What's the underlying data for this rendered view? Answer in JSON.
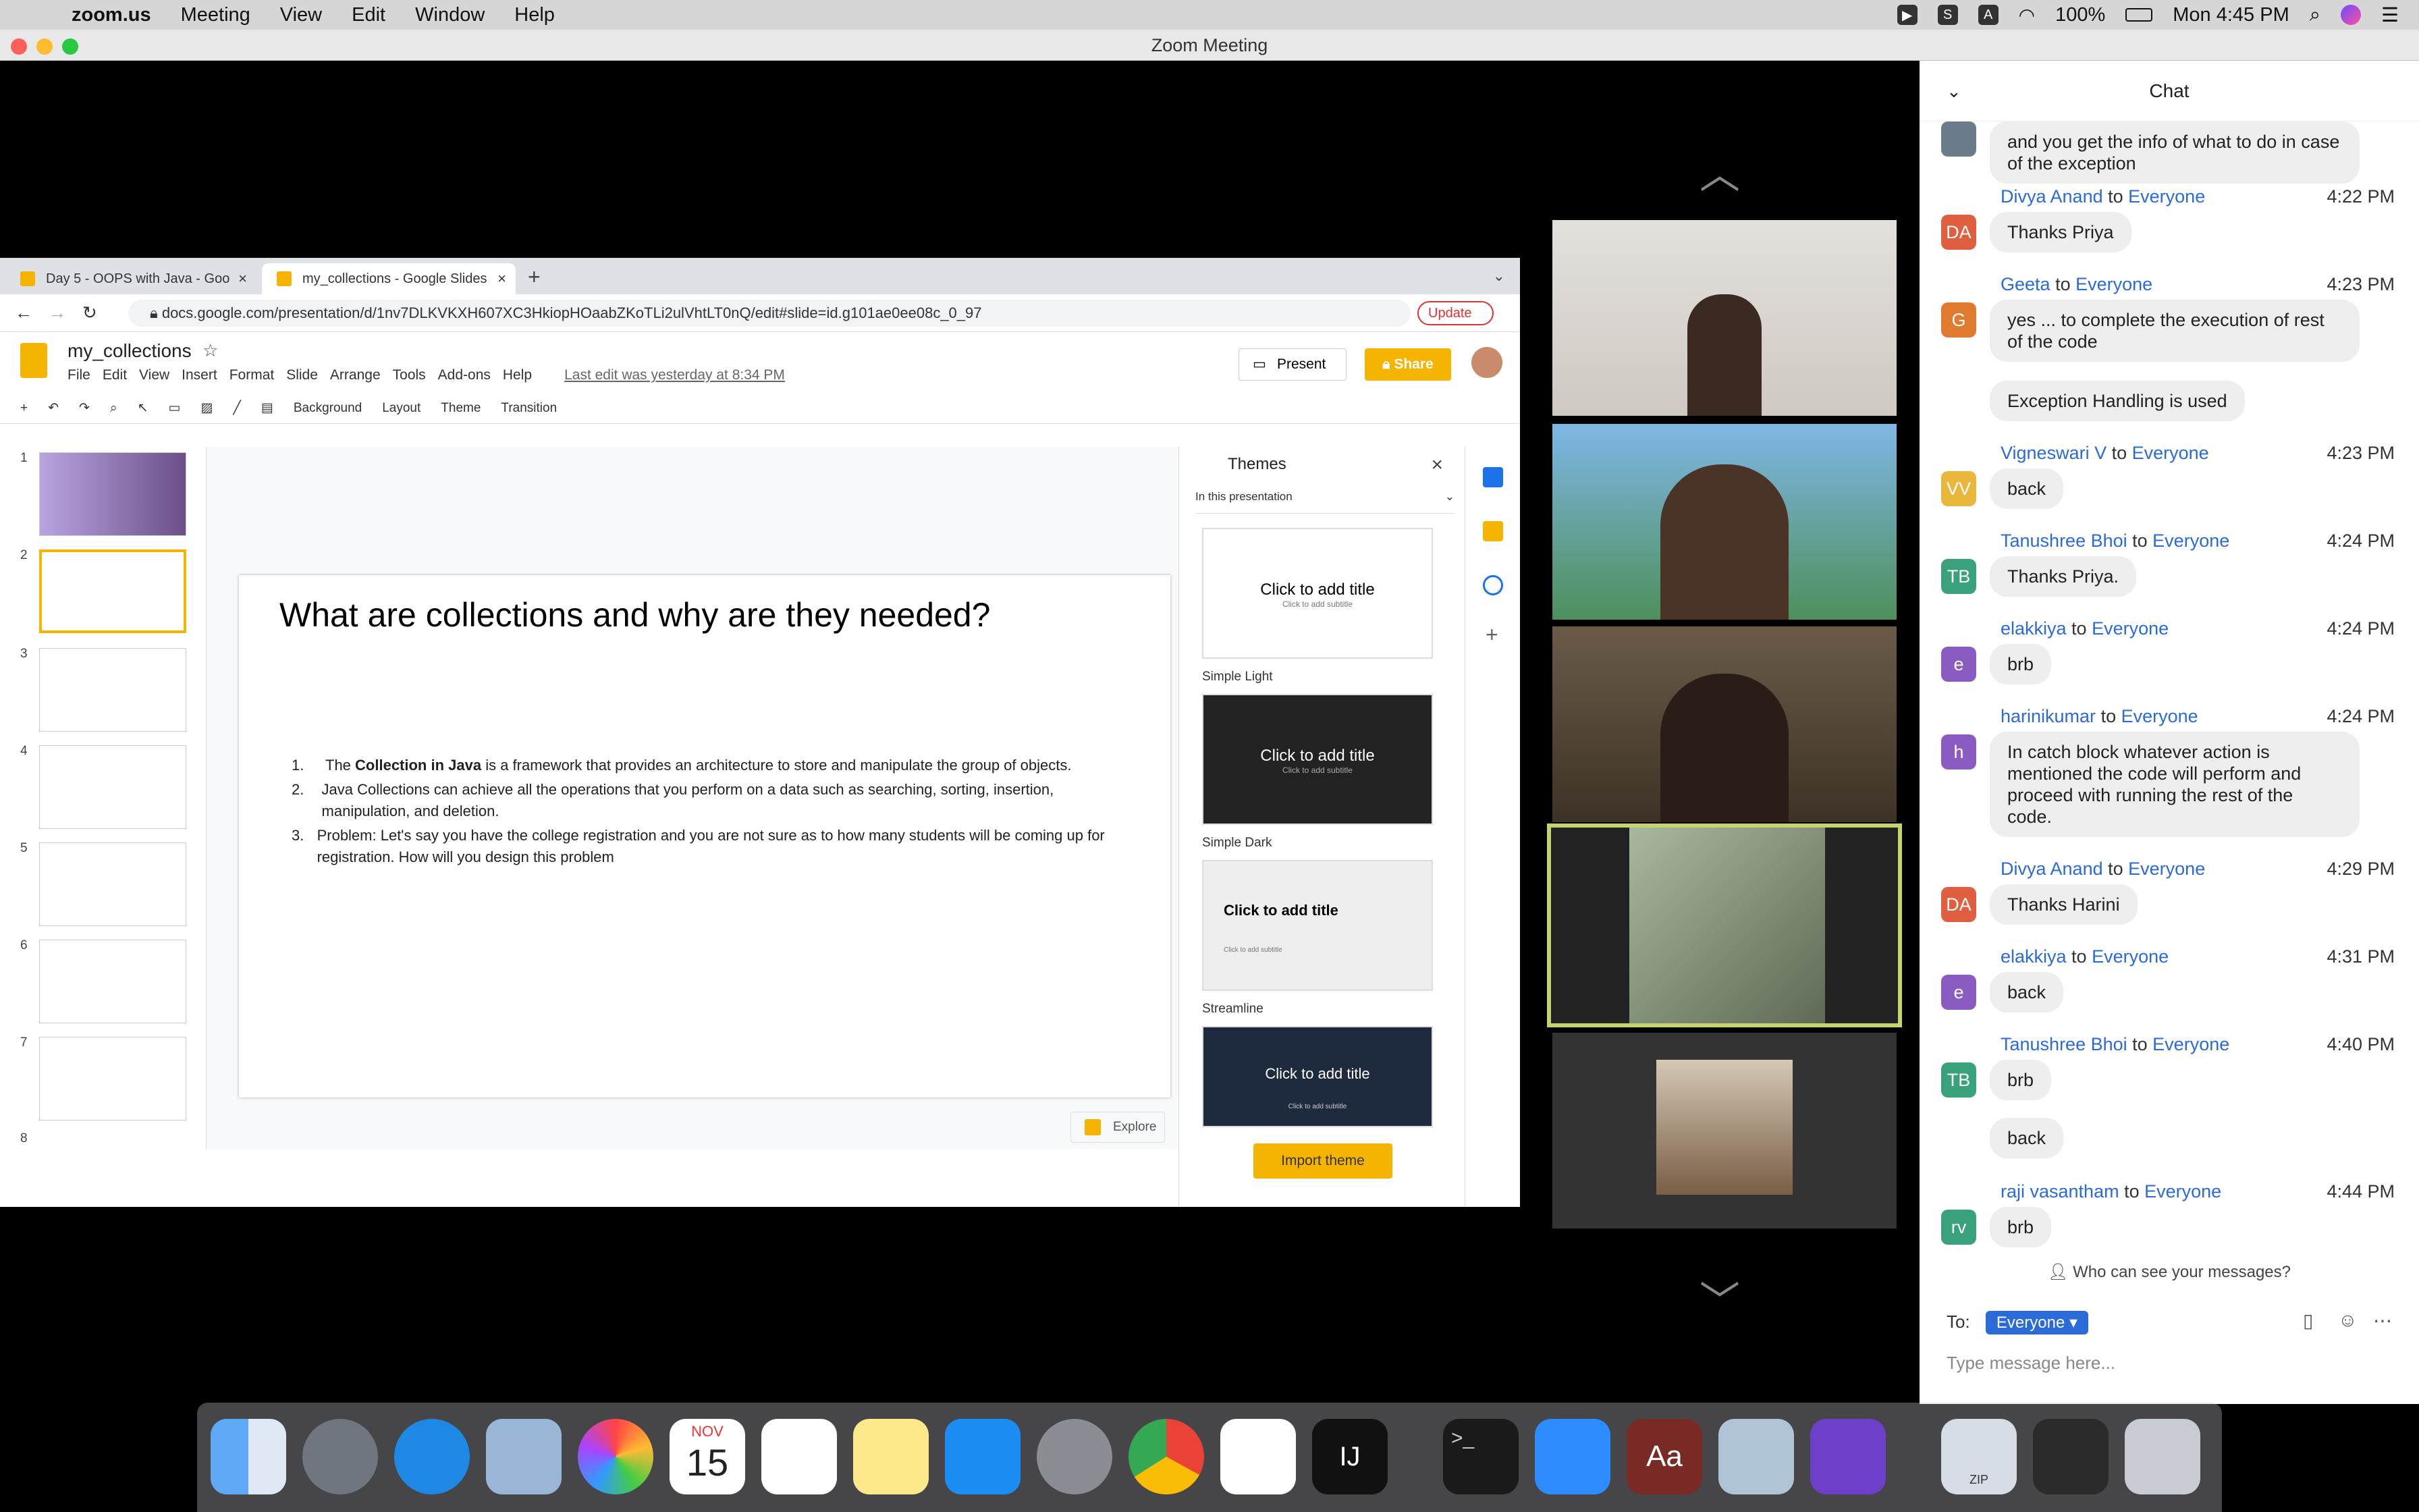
{
  "menubar": {
    "app": "zoom.us",
    "items": [
      "Meeting",
      "View",
      "Edit",
      "Window",
      "Help"
    ],
    "battery": "100%",
    "clock": "Mon 4:45 PM"
  },
  "window_title": "Zoom Meeting",
  "browser": {
    "tab1": "Day 5 - OOPS with Java - Goo",
    "tab2": "my_collections - Google Slides",
    "url": "docs.google.com/presentation/d/1nv7DLKVKXH607XC3HkiopHOaabZKoTLi2ulVhtLT0nQ/edit#slide=id.g101ae0ee08c_0_97",
    "update": "Update"
  },
  "slides_app": {
    "doc_name": "my_collections",
    "menus": [
      "File",
      "Edit",
      "View",
      "Insert",
      "Format",
      "Slide",
      "Arrange",
      "Tools",
      "Add-ons",
      "Help"
    ],
    "last_edit": "Last edit was yesterday at 8:34 PM",
    "present": "Present",
    "share": "Share",
    "toolbar": [
      "Background",
      "Layout",
      "Theme",
      "Transition"
    ],
    "slide_numbers": [
      "1",
      "2",
      "3",
      "4",
      "5",
      "6",
      "7",
      "8"
    ],
    "slide": {
      "title": "What are collections and why are they needed?",
      "items": [
        {
          "num": "1.",
          "bold_prefix": "The ",
          "bold": "Collection in Java",
          "text": " is a framework that provides an architecture to store and manipulate the group of objects."
        },
        {
          "num": "2.",
          "bold_prefix": "",
          "bold": "",
          "text": "Java Collections can achieve all the operations that you perform on a data such as searching, sorting, insertion, manipulation, and deletion."
        },
        {
          "num": "3.",
          "bold_prefix": "",
          "bold": "",
          "text": "Problem: Let's say you have the college registration and you are not sure as to how many students will be coming up for registration. How will you design this problem"
        }
      ]
    },
    "explore": "Explore",
    "themes": {
      "header": "Themes",
      "subheader": "In this presentation",
      "cards": [
        {
          "title": "Click to add title",
          "subtitle": "Click to add subtitle",
          "name": "Simple Light"
        },
        {
          "title": "Click to add title",
          "subtitle": "Click to add subtitle",
          "name": "Simple Dark"
        },
        {
          "title": "Click to add title",
          "subtitle": "Click to add subtitle",
          "name": "Streamline"
        },
        {
          "title": "Click to add title",
          "subtitle": "Click to add subtitle",
          "name": ""
        }
      ],
      "import": "Import theme"
    }
  },
  "chat": {
    "header": "Chat",
    "messages": [
      {
        "bubble": "and you get the info of what to do in case of the exception"
      },
      {
        "sender": "Divya Anand",
        "to": " to ",
        "target": "Everyone",
        "time": "4:22 PM",
        "initials": "DA",
        "bubble": "Thanks Priya"
      },
      {
        "sender": "Geeta",
        "to": " to ",
        "target": "Everyone",
        "time": "4:23 PM",
        "initials": "G",
        "bubble": "yes ... to complete the execution of rest of the code",
        "bubble2": "Exception Handling is used"
      },
      {
        "sender": "Vigneswari V",
        "to": " to ",
        "target": "Everyone",
        "time": "4:23 PM",
        "initials": "VV",
        "bubble": "back"
      },
      {
        "sender": "Tanushree Bhoi",
        "to": " to ",
        "target": "Everyone",
        "time": "4:24 PM",
        "initials": "TB",
        "bubble": "Thanks Priya."
      },
      {
        "sender": "elakkiya",
        "to": " to ",
        "target": "Everyone",
        "time": "4:24 PM",
        "initials": "e",
        "bubble": "brb"
      },
      {
        "sender": "harinikumar",
        "to": " to ",
        "target": "Everyone",
        "time": "4:24 PM",
        "initials": "h",
        "bubble": "In catch block whatever action is mentioned the code will perform and proceed with running the rest of the code."
      },
      {
        "sender": "Divya Anand",
        "to": " to ",
        "target": "Everyone",
        "time": "4:29 PM",
        "initials": "DA",
        "bubble": "Thanks Harini"
      },
      {
        "sender": "elakkiya",
        "to": " to ",
        "target": "Everyone",
        "time": "4:31 PM",
        "initials": "e",
        "bubble": "back"
      },
      {
        "sender": "Tanushree Bhoi",
        "to": " to ",
        "target": "Everyone",
        "time": "4:40 PM",
        "initials": "TB",
        "bubble": "brb",
        "bubble2": "back"
      },
      {
        "sender": "raji vasantham",
        "to": " to ",
        "target": "Everyone",
        "time": "4:44 PM",
        "initials": "rv",
        "bubble": "brb"
      }
    ],
    "who": "Who can see your messages?",
    "to_label": "To:",
    "to_value": "Everyone",
    "placeholder": "Type message here..."
  },
  "dock": {
    "calendar_month": "NOV",
    "calendar_day": "15",
    "zip_label": "ZIP"
  },
  "colors": {
    "accent_blue": "#2a6bd8",
    "slides_yellow": "#f4b400",
    "active_speaker": "#c6d36e"
  }
}
